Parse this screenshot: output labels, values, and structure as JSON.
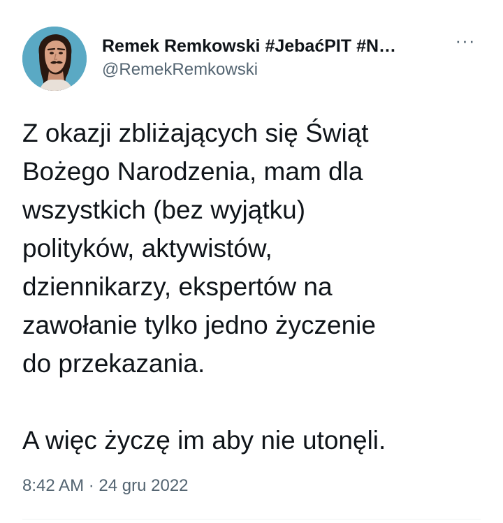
{
  "tweet": {
    "author": {
      "display_name": "Remek Remkowski #JebaćPIT #N…",
      "handle": "@RemekRemkowski",
      "avatar_icon": "profile-photo"
    },
    "more_label": "···",
    "text_paragraphs": [
      "Z okazji zbliżających się Świąt\nBożego Narodzenia, mam dla\nwszystkich (bez wyjątku)\npolityków, aktywistów,\ndziennikarzy, ekspertów na\nzawołanie tylko jedno życzenie\ndo przekazania.",
      "A więc życzę im aby nie utonęli."
    ],
    "time": "8:42 AM",
    "separator": "·",
    "date": "24 gru 2022"
  },
  "colors": {
    "text": "#0f1419",
    "secondary": "#536471",
    "avatar_bg": "#5aa9c4",
    "divider": "#eff3f4"
  }
}
